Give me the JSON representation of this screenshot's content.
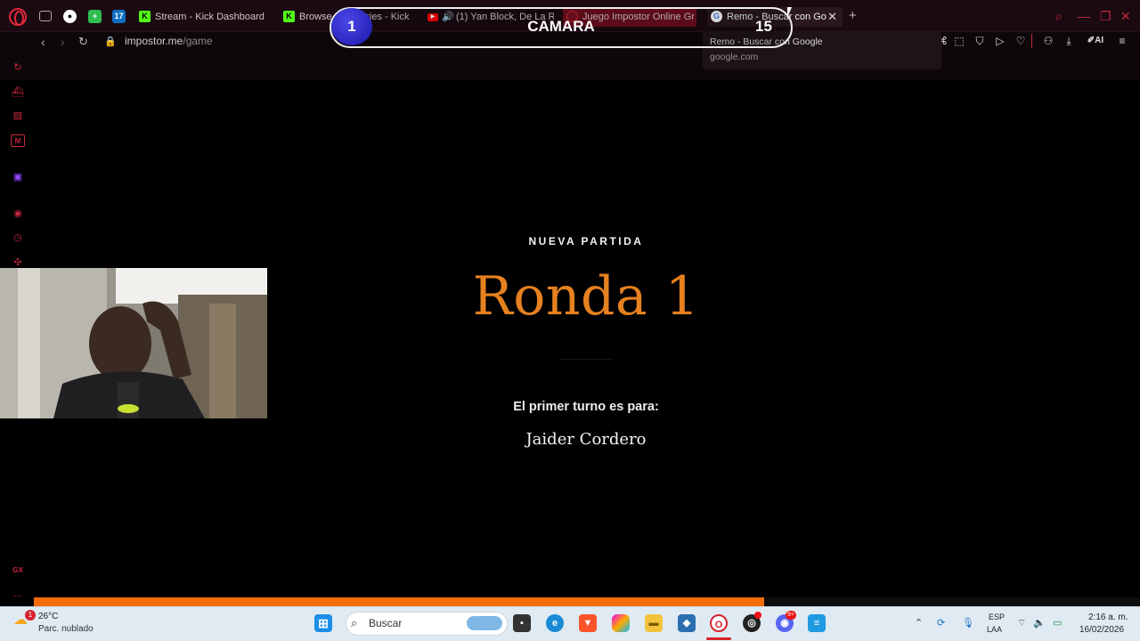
{
  "tabs": {
    "stream": "Stream - Kick Dashboard",
    "browse": "Browse Categories - Kick",
    "youtube": "(1) Yan Block, De La R",
    "juego": "Juego Impostor Online Gr",
    "remo": "Remo - Buscar con Go"
  },
  "address": {
    "domain": "impostor.me",
    "path": "/game"
  },
  "tooltip": {
    "title": "Remo - Buscar con Google",
    "url": "google.com"
  },
  "overlay": {
    "left_number": "1",
    "label": "CAMARA",
    "right_number": "15"
  },
  "main": {
    "subtitle": "NUEVA PARTIDA",
    "title": "Ronda 1",
    "turn_label": "El primer turno es para:",
    "player": "Jaider Cordero"
  },
  "progress": {
    "fraction": 0.66,
    "color": "#f46b0a"
  },
  "taskbar": {
    "weather_temp": "26°C",
    "weather_desc": "Parc. nublado",
    "weather_badge": "1",
    "search_placeholder": "Buscar",
    "lang_line1": "ESP",
    "lang_line2": "LAA",
    "time": "2:16 a. m.",
    "date": "16/02/2026"
  },
  "colors": {
    "accent": "#c7283d",
    "title": "#e6811f"
  }
}
